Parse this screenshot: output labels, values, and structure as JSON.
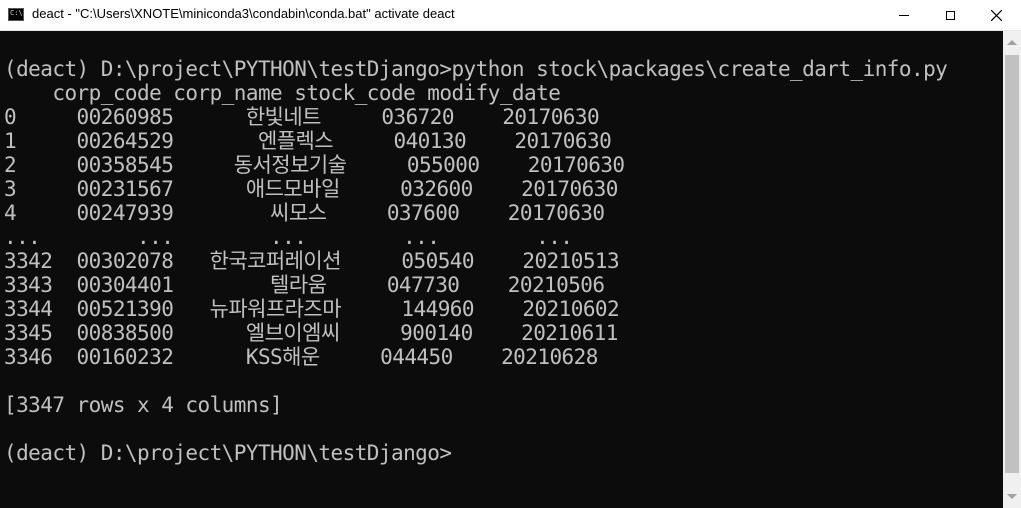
{
  "window": {
    "title": "deact - \"C:\\Users\\XNOTE\\miniconda3\\condabin\\conda.bat\"  activate deact",
    "icon": "cmd-icon"
  },
  "console": {
    "lines": [
      "(deact) D:\\project\\PYTHON\\testDjango>python stock\\packages\\create_dart_info.py",
      "    corp_code corp_name stock_code modify_date",
      "0     00260985      한빛네트     036720    20170630",
      "1     00264529       엔플렉스     040130    20170630",
      "2     00358545     동서정보기술     055000    20170630",
      "3     00231567      애드모바일     032600    20170630",
      "4     00247939        씨모스     037600    20170630",
      "...        ...        ...        ...        ...",
      "3342  00302078   한국코퍼레이션     050540    20210513",
      "3343  00304401        텔라움     047730    20210506",
      "3344  00521390   뉴파워프라즈마     144960    20210602",
      "3345  00838500      엘브이엠씨     900140    20210611",
      "3346  00160232      KSS해운     044450    20210628",
      "",
      "[3347 rows x 4 columns]",
      "",
      "(deact) D:\\project\\PYTHON\\testDjango>"
    ]
  }
}
